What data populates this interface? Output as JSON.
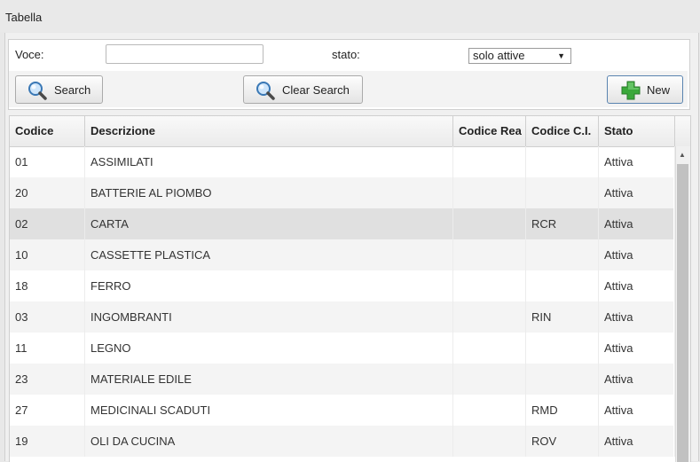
{
  "panel": {
    "title": "Tabella"
  },
  "filters": {
    "voce_label": "Voce:",
    "voce_value": "",
    "stato_label": "stato:",
    "stato_selected": "solo attive"
  },
  "buttons": {
    "search": "Search",
    "clear_search": "Clear Search",
    "new": "New"
  },
  "grid": {
    "columns": [
      "Codice",
      "Descrizione",
      "Codice Rea",
      "Codice C.I.",
      "Stato"
    ],
    "rows": [
      {
        "codice": "01",
        "descrizione": "ASSIMILATI",
        "rea": "",
        "ci": "",
        "stato": "Attiva"
      },
      {
        "codice": "20",
        "descrizione": "BATTERIE AL PIOMBO",
        "rea": "",
        "ci": "",
        "stato": "Attiva"
      },
      {
        "codice": "02",
        "descrizione": "CARTA",
        "rea": "",
        "ci": "RCR",
        "stato": "Attiva"
      },
      {
        "codice": "10",
        "descrizione": "CASSETTE PLASTICA",
        "rea": "",
        "ci": "",
        "stato": "Attiva"
      },
      {
        "codice": "18",
        "descrizione": "FERRO",
        "rea": "",
        "ci": "",
        "stato": "Attiva"
      },
      {
        "codice": "03",
        "descrizione": "INGOMBRANTI",
        "rea": "",
        "ci": "RIN",
        "stato": "Attiva"
      },
      {
        "codice": "11",
        "descrizione": "LEGNO",
        "rea": "",
        "ci": "",
        "stato": "Attiva"
      },
      {
        "codice": "23",
        "descrizione": "MATERIALE EDILE",
        "rea": "",
        "ci": "",
        "stato": "Attiva"
      },
      {
        "codice": "27",
        "descrizione": "MEDICINALI SCADUTI",
        "rea": "",
        "ci": "RMD",
        "stato": "Attiva"
      },
      {
        "codice": "19",
        "descrizione": "OLI DA CUCINA",
        "rea": "",
        "ci": "ROV",
        "stato": "Attiva"
      }
    ],
    "selected_row": 2
  },
  "colors": {
    "accent_new": "#3aa83a",
    "selected_row": "#e0e0e0"
  }
}
